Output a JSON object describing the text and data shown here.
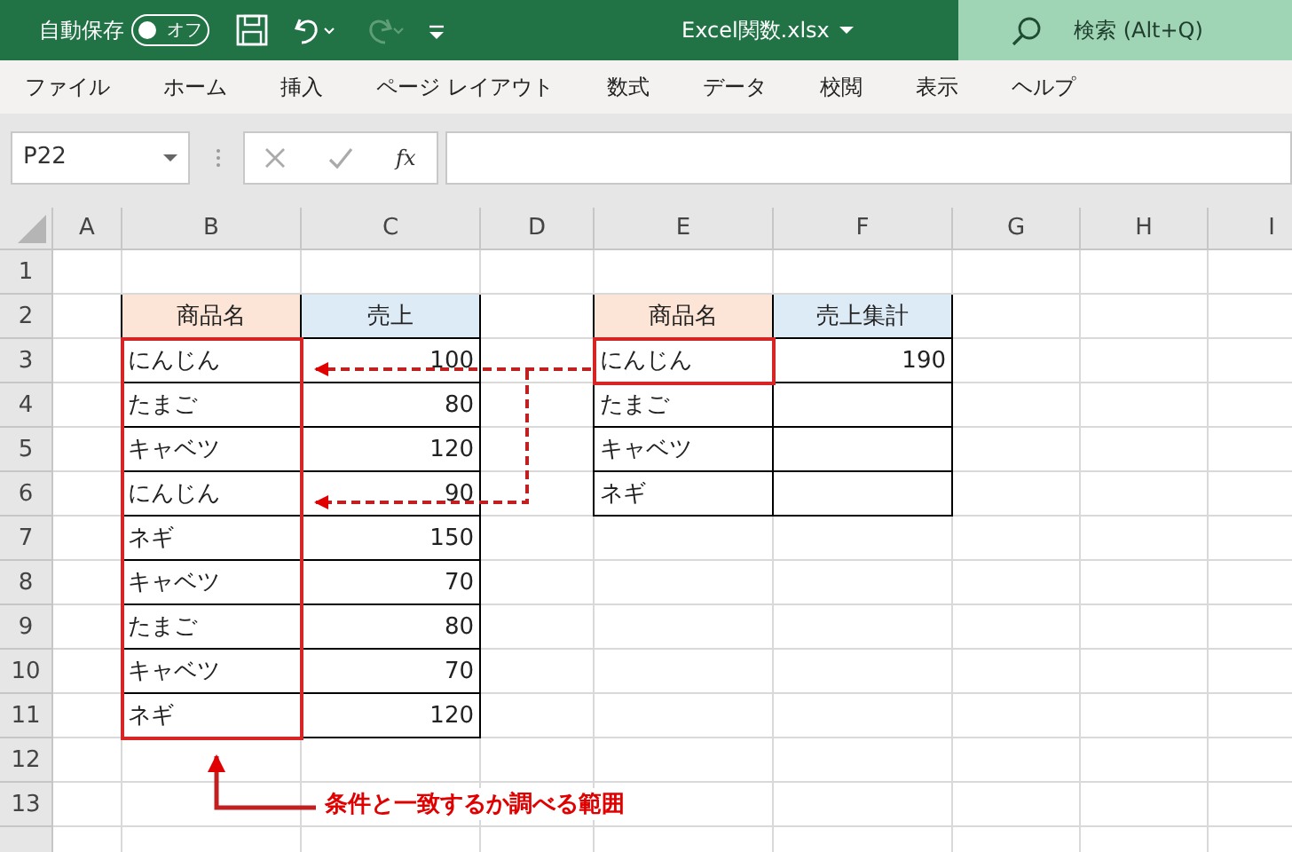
{
  "title_bar": {
    "autosave_label": "自動保存",
    "autosave_toggle": {
      "label": "オフ",
      "on": false
    },
    "filename": "Excel関数.xlsx",
    "search_placeholder": "検索 (Alt+Q)"
  },
  "ribbon_tabs": [
    {
      "label": "ファイル"
    },
    {
      "label": "ホーム"
    },
    {
      "label": "挿入"
    },
    {
      "label": "ページ レイアウト"
    },
    {
      "label": "数式"
    },
    {
      "label": "データ"
    },
    {
      "label": "校閲"
    },
    {
      "label": "表示"
    },
    {
      "label": "ヘルプ"
    }
  ],
  "formula_bar": {
    "name_box": "P22",
    "fx_label": "fx"
  },
  "sheet": {
    "columns": [
      "A",
      "B",
      "C",
      "D",
      "E",
      "F",
      "G",
      "H",
      "I"
    ],
    "row_numbers": [
      "1",
      "2",
      "3",
      "4",
      "5",
      "6",
      "7",
      "8",
      "9",
      "10",
      "11",
      "12",
      "13"
    ],
    "tables": [
      {
        "headers": [
          "商品名",
          "売上"
        ],
        "rows": [
          [
            "にんじん",
            "100"
          ],
          [
            "たまご",
            "80"
          ],
          [
            "キャベツ",
            "120"
          ],
          [
            "にんじん",
            "90"
          ],
          [
            "ネギ",
            "150"
          ],
          [
            "キャベツ",
            "70"
          ],
          [
            "たまご",
            "80"
          ],
          [
            "キャベツ",
            "70"
          ],
          [
            "ネギ",
            "120"
          ]
        ]
      },
      {
        "headers": [
          "商品名",
          "売上集計"
        ],
        "rows": [
          [
            "にんじん",
            "190"
          ],
          [
            "たまご"
          ],
          [
            "キャベツ"
          ],
          [
            "ネギ"
          ]
        ]
      }
    ]
  },
  "callout": {
    "text": "条件と一致するか調べる範囲"
  }
}
